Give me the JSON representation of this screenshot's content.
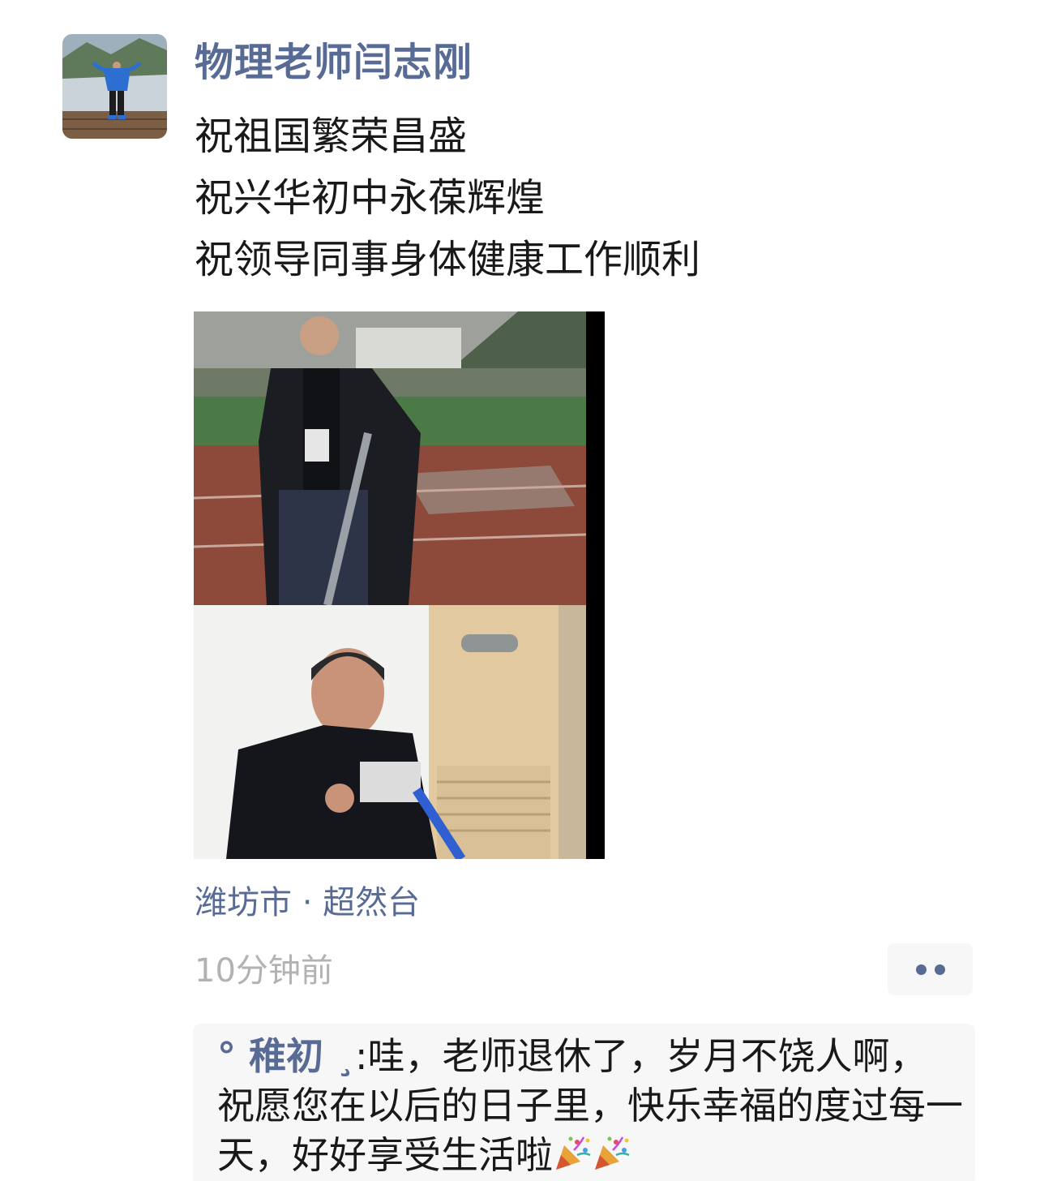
{
  "post": {
    "author": "物理老师闫志刚",
    "lines": [
      "祝祖国繁荣昌盛",
      "祝兴华初中永葆辉煌",
      "祝领导同事身体健康工作顺利"
    ],
    "location": "潍坊市 · 超然台",
    "time": "10分钟前"
  },
  "comment": {
    "author": "° 稚初 ¸",
    "separator": ":",
    "text": "哇，老师退休了，岁月不饶人啊，祝愿您在以后的日子里，快乐幸福的度过每一天，好好享受生活啦",
    "emojis": [
      "party-popper-icon",
      "party-popper-icon"
    ]
  },
  "colors": {
    "link": "#576b95",
    "text": "#191919",
    "muted": "#b2b2b2",
    "panel": "#f7f7f7"
  }
}
